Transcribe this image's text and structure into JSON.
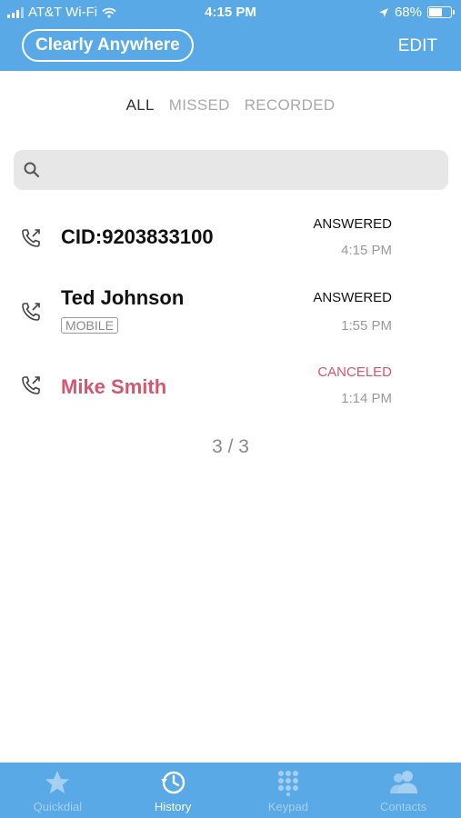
{
  "status_bar": {
    "carrier": "AT&T Wi-Fi",
    "time": "4:15 PM",
    "battery": "68%",
    "battery_level": 0.68
  },
  "header": {
    "account": "Clearly Anywhere",
    "edit": "EDIT"
  },
  "filters": [
    {
      "label": "ALL",
      "active": true
    },
    {
      "label": "MISSED",
      "active": false
    },
    {
      "label": "RECORDED",
      "active": false
    }
  ],
  "search": {
    "placeholder": "",
    "value": ""
  },
  "calls": [
    {
      "name": "CID:9203833100",
      "badge": "",
      "status": "ANSWERED",
      "time": "4:15 PM",
      "missed": false
    },
    {
      "name": "Ted Johnson",
      "badge": "MOBILE",
      "status": "ANSWERED",
      "time": "1:55 PM",
      "missed": false
    },
    {
      "name": "Mike Smith",
      "badge": "",
      "status": "CANCELED",
      "time": "1:14 PM",
      "missed": true
    }
  ],
  "pager": "3 / 3",
  "tabbar": [
    {
      "label": "Quickdial",
      "icon": "star-icon",
      "active": false
    },
    {
      "label": "History",
      "icon": "history-icon",
      "active": true
    },
    {
      "label": "Keypad",
      "icon": "keypad-icon",
      "active": false
    },
    {
      "label": "Contacts",
      "icon": "contacts-icon",
      "active": false
    }
  ],
  "colors": {
    "accent": "#58a9e6",
    "missed": "#d4566f"
  }
}
